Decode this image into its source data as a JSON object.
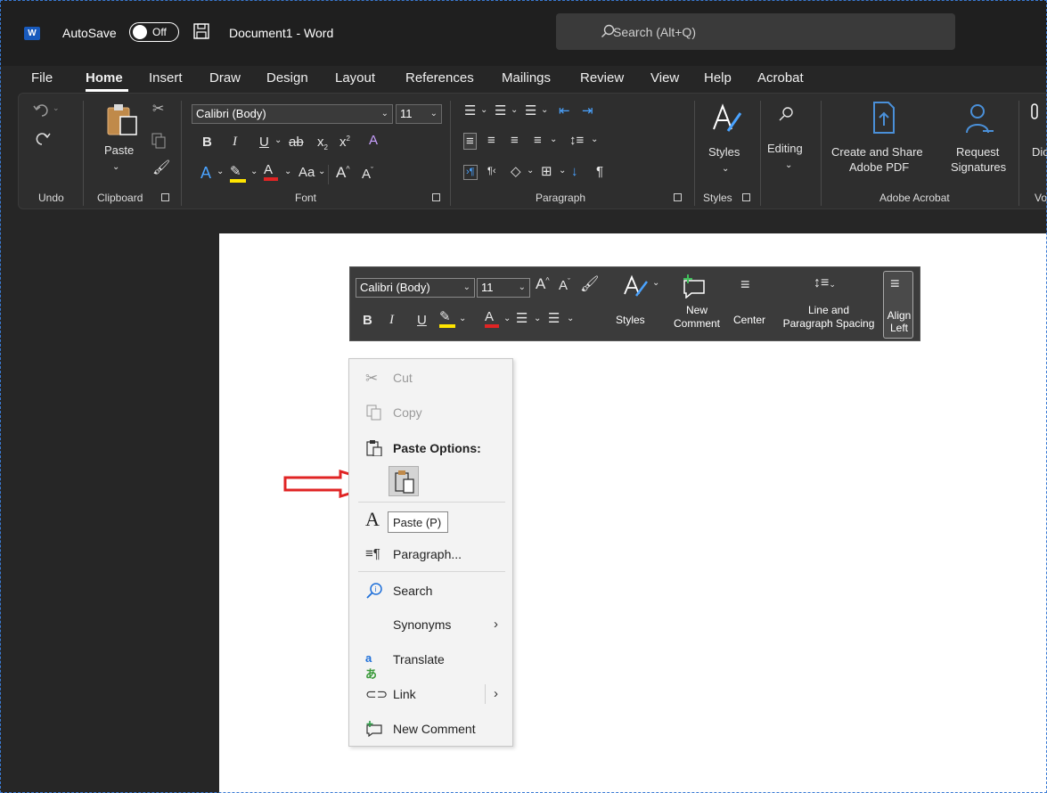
{
  "titlebar": {
    "app_logo": "W",
    "autosave_label": "AutoSave",
    "autosave_state": "Off",
    "document_title": "Document1  -  Word",
    "search_placeholder": "Search (Alt+Q)"
  },
  "tabs": [
    "File",
    "Home",
    "Insert",
    "Draw",
    "Design",
    "Layout",
    "References",
    "Mailings",
    "Review",
    "View",
    "Help",
    "Acrobat"
  ],
  "active_tab": "Home",
  "ribbon": {
    "font_name": "Calibri (Body)",
    "font_size": "11",
    "paste_label": "Paste",
    "styles_label": "Styles",
    "editing_label": "Editing",
    "create_share_line1": "Create and Share",
    "create_share_line2": "Adobe PDF",
    "request_line1": "Request",
    "request_line2": "Signatures",
    "dictate_partial": "Dic",
    "groups": {
      "undo": "Undo",
      "clipboard": "Clipboard",
      "font": "Font",
      "paragraph": "Paragraph",
      "styles": "Styles",
      "adobe": "Adobe Acrobat",
      "voice_partial": "Vo"
    },
    "font_buttons": {
      "bold": "B",
      "italic": "I",
      "underline": "U",
      "strike": "ab",
      "subscript": "x",
      "superscript": "x",
      "text_effect": "A",
      "font_color": "A",
      "change_case": "Aa",
      "grow": "A",
      "shrink": "A"
    },
    "pilcrow": "¶"
  },
  "mini_toolbar": {
    "font_name": "Calibri (Body)",
    "font_size": "11",
    "bold": "B",
    "italic": "I",
    "underline": "U",
    "styles": "Styles",
    "new_comment_line1": "New",
    "new_comment_line2": "Comment",
    "center": "Center",
    "line_spacing_line1": "Line and",
    "line_spacing_line2": "Paragraph Spacing",
    "align_left_line1": "Align",
    "align_left_line2": "Left"
  },
  "context_menu": {
    "cut": "Cut",
    "copy": "Copy",
    "paste_options": "Paste Options:",
    "paste_tooltip": "Paste (P)",
    "paragraph": "Paragraph...",
    "search": "Search",
    "synonyms": "Synonyms",
    "translate": "Translate",
    "link": "Link",
    "new_comment": "New Comment"
  },
  "colors": {
    "accent_red_arrow": "#e02424",
    "highlight_yellow": "#ffe500",
    "font_red": "#e02424",
    "word_blue": "#185abd",
    "adobe_blue": "#4a90d9"
  }
}
